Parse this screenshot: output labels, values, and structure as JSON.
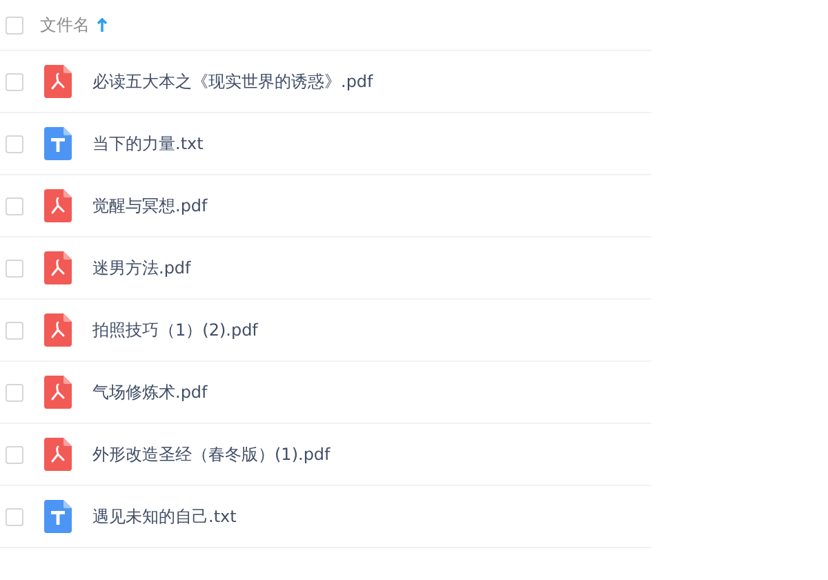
{
  "header": {
    "checked": false,
    "column": "文件名"
  },
  "files": [
    {
      "name": "必读五大本之《现实世界的诱惑》.pdf",
      "kind": "pdf",
      "checked": false
    },
    {
      "name": "当下的力量.txt",
      "kind": "txt",
      "checked": false
    },
    {
      "name": "觉醒与冥想.pdf",
      "kind": "pdf",
      "checked": false
    },
    {
      "name": "迷男方法.pdf",
      "kind": "pdf",
      "checked": false
    },
    {
      "name": "拍照技巧（1）(2).pdf",
      "kind": "pdf",
      "checked": false
    },
    {
      "name": "气场修炼术.pdf",
      "kind": "pdf",
      "checked": false
    },
    {
      "name": "外形改造圣经（春冬版）(1).pdf",
      "kind": "pdf",
      "checked": false
    },
    {
      "name": "遇见未知的自己.txt",
      "kind": "txt",
      "checked": false
    }
  ]
}
